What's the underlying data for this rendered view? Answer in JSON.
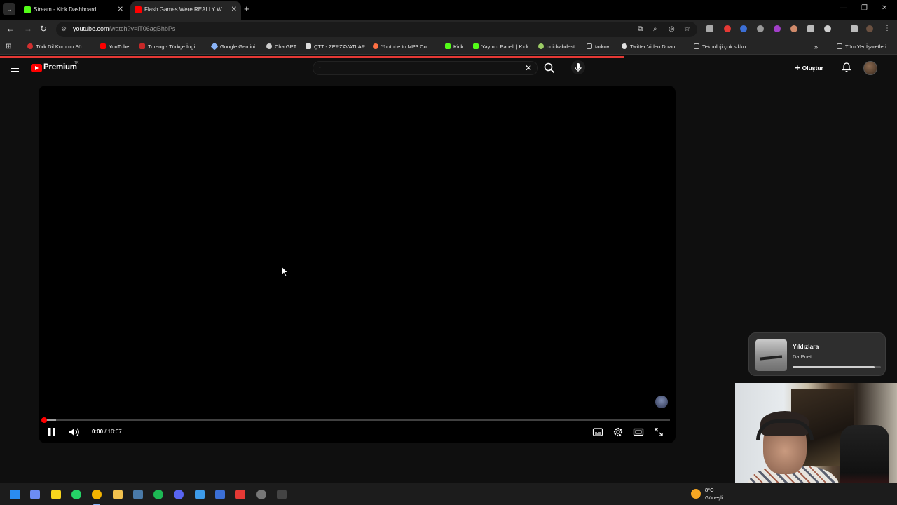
{
  "browser": {
    "tabs": [
      {
        "title": "Stream - Kick Dashboard",
        "favicon": "kick-icon",
        "color": "#53fc18",
        "active": false
      },
      {
        "title": "Flash Games Were REALLY W",
        "favicon": "youtube-icon",
        "color": "#ff0000",
        "active": true
      }
    ],
    "url": {
      "host": "youtube.com",
      "path": "/watch?v=iT06agBhbPs"
    },
    "bookmarks": [
      {
        "label": "Türk Dil Kurumu Sö...",
        "icon": "tdk-icon",
        "color": "#d32f2f"
      },
      {
        "label": "YouTube",
        "icon": "youtube-icon",
        "color": "#ff0000"
      },
      {
        "label": "Tureng - Türkçe İngi...",
        "icon": "tureng-icon",
        "color": "#c62828"
      },
      {
        "label": "Google Gemini",
        "icon": "gemini-icon",
        "color": "#8ab4f8"
      },
      {
        "label": "ChatGPT",
        "icon": "chatgpt-icon",
        "color": "#cccccc"
      },
      {
        "label": "ÇTT - ZERZAVATLAR",
        "icon": "notion-icon",
        "color": "#dddddd"
      },
      {
        "label": "Youtube to MP3 Co...",
        "icon": "mp3-icon",
        "color": "#ff7043"
      },
      {
        "label": "Kick",
        "icon": "kick-icon",
        "color": "#53fc18"
      },
      {
        "label": "Yayıncı Paneli | Kick",
        "icon": "kick-icon",
        "color": "#53fc18"
      },
      {
        "label": "quickabdest",
        "icon": "globe-icon",
        "color": "#9ccc65"
      },
      {
        "label": "tarkov",
        "icon": "folder-icon",
        "color": "#bbbbbb"
      },
      {
        "label": "Twitter Video Downl...",
        "icon": "globe-icon",
        "color": "#e0e0e0"
      },
      {
        "label": "Teknoloji çok sikko...",
        "icon": "folder-icon",
        "color": "#bbbbbb"
      }
    ],
    "all_bookmarks": "Tüm Yer İşaretleri"
  },
  "youtube": {
    "brand": "Premium",
    "region": "TR",
    "search_value": "-",
    "create_label": "Oluştur"
  },
  "player": {
    "current_time": "0:00",
    "duration": "10:07",
    "played_fraction": 0.0
  },
  "now_playing": {
    "title": "Yıldızlara",
    "artist": "Da Poet",
    "progress_fraction": 0.93
  },
  "weather": {
    "temp": "8°C",
    "condition": "Güneşli"
  },
  "taskbar": {
    "apps": [
      {
        "name": "windows-start-icon",
        "color": "#2a8cf0"
      },
      {
        "name": "copilot-icon",
        "color": "#6c8cf5"
      },
      {
        "name": "sticky-notes-icon",
        "color": "#f7d51d"
      },
      {
        "name": "whatsapp-icon",
        "color": "#25d366"
      },
      {
        "name": "chrome-icon",
        "color": "#f4b400"
      },
      {
        "name": "file-explorer-icon",
        "color": "#f2c14e"
      },
      {
        "name": "steam-icon",
        "color": "#4a7aa8"
      },
      {
        "name": "spotify-icon",
        "color": "#1db954"
      },
      {
        "name": "discord-icon",
        "color": "#5865f2"
      },
      {
        "name": "app-icon",
        "color": "#3d9be9"
      },
      {
        "name": "mail-icon",
        "color": "#3b6fd6"
      },
      {
        "name": "acrobat-icon",
        "color": "#e53935"
      },
      {
        "name": "obs-icon",
        "color": "#777777"
      },
      {
        "name": "terminal-icon",
        "color": "#444444"
      }
    ]
  }
}
